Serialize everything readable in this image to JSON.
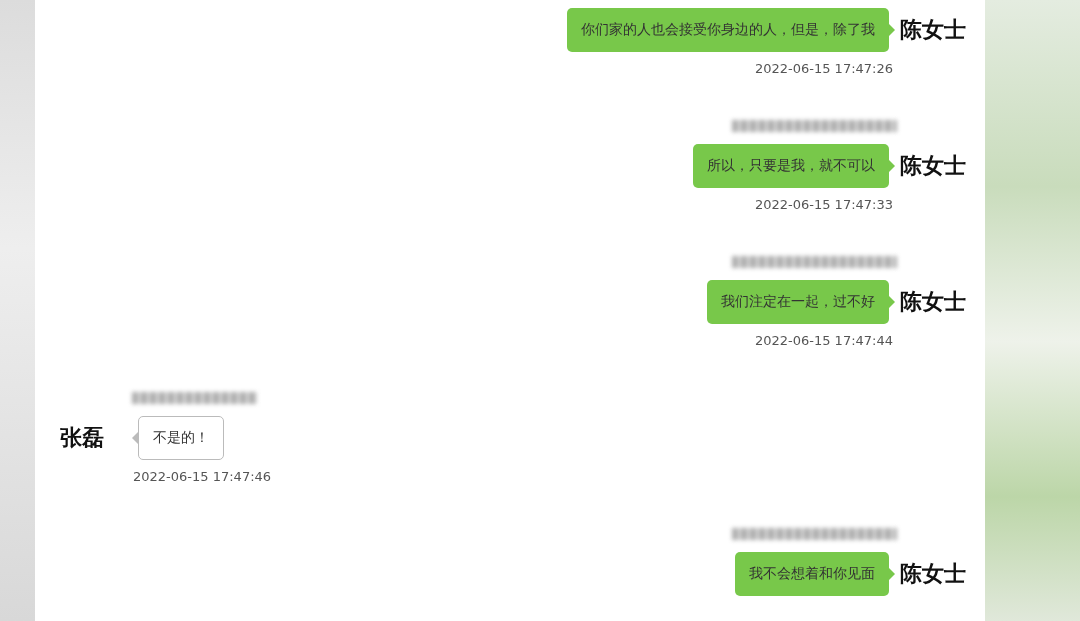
{
  "messages": [
    {
      "kind": "outgoing",
      "sender": "陈女士",
      "text": "你们家的人也会接受你身边的人，但是，除了我",
      "time": "2022-06-15 17:47:26"
    },
    {
      "kind": "outgoing",
      "sender": "陈女士",
      "text": "所以，只要是我，就不可以",
      "time": "2022-06-15 17:47:33",
      "redacted_header": true
    },
    {
      "kind": "outgoing",
      "sender": "陈女士",
      "text": "我们注定在一起，过不好",
      "time": "2022-06-15 17:47:44",
      "redacted_header": true
    },
    {
      "kind": "incoming",
      "sender": "张磊",
      "text": "不是的！",
      "time": "2022-06-15 17:47:46",
      "redacted_header": true
    },
    {
      "kind": "outgoing",
      "sender": "陈女士",
      "text": "我不会想着和你见面",
      "redacted_header": true
    }
  ]
}
